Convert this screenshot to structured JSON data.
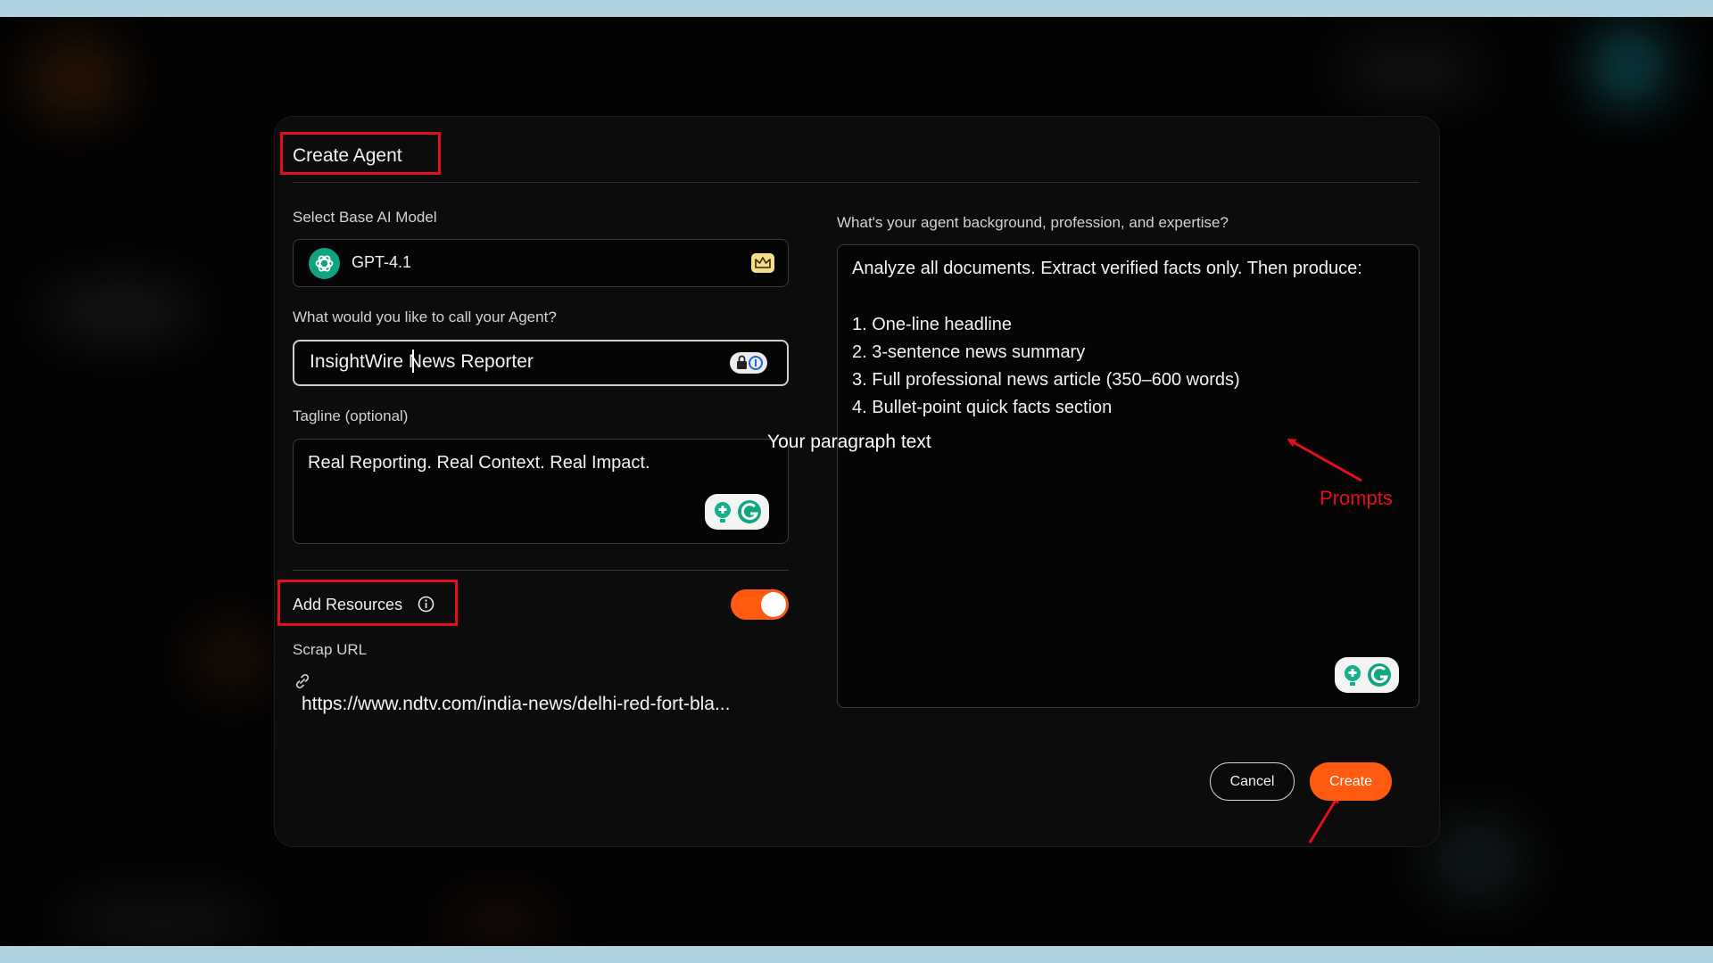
{
  "modal": {
    "title": "Create Agent"
  },
  "base_model": {
    "label": "Select Base AI Model",
    "value": "GPT-4.1",
    "logo_icon": "openai-icon",
    "badge_icon": "crown-icon"
  },
  "agent_name": {
    "label": "What would you like to call your Agent?",
    "value": "InsightWire News Reporter",
    "cursor_after": "InsightWire"
  },
  "tagline": {
    "label": "Tagline (optional)",
    "value": "Real Reporting. Real Context. Real Impact."
  },
  "resources": {
    "label": "Add Resources",
    "toggle_on": true,
    "scrap_url_label": "Scrap URL",
    "scrap_url_value": "https://www.ndtv.com/india-news/delhi-red-fort-bla..."
  },
  "background": {
    "label": "What's your agent background, profession, and expertise?",
    "value": "Analyze all documents. Extract verified facts only. Then produce:\n\n1. One-line headline\n2. 3-sentence news summary\n3. Full professional news article (350–600 words)\n4. Bullet-point quick facts section"
  },
  "overlay_text": "Your paragraph text",
  "annotation": {
    "prompts_label": "Prompts",
    "color": "#e3101c"
  },
  "buttons": {
    "cancel": "Cancel",
    "create": "Create"
  },
  "colors": {
    "accent": "#ff5a0f",
    "highlight": "#e3101c",
    "model_logo": "#10a37f",
    "frame": "#add4e0"
  }
}
